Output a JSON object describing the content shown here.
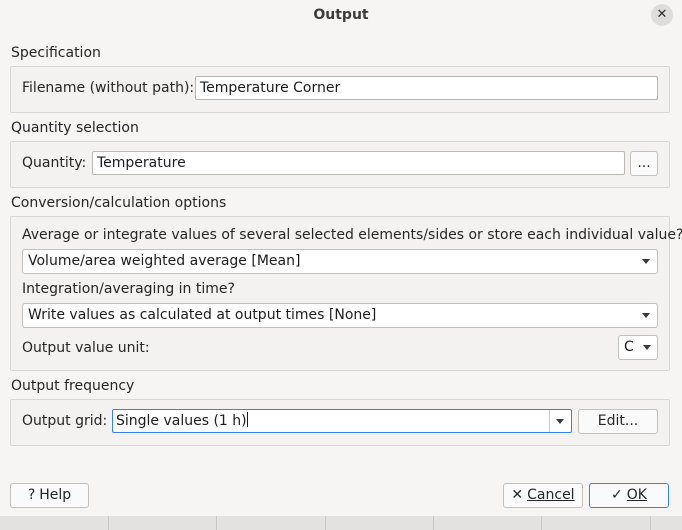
{
  "window": {
    "title": "Output",
    "close_glyph": "✕"
  },
  "specification": {
    "heading": "Specification",
    "filename_label": "Filename (without path):",
    "filename_value": "Temperature Corner"
  },
  "quantity_selection": {
    "heading": "Quantity selection",
    "quantity_label": "Quantity:",
    "quantity_value": "Temperature",
    "browse_label": "..."
  },
  "conversion": {
    "heading": "Conversion/calculation options",
    "average_question": "Average or integrate values of several selected elements/sides or store each individual value?",
    "average_selected": "Volume/area weighted average [Mean]",
    "time_question": "Integration/averaging in time?",
    "time_selected": "Write values as calculated at output times [None]",
    "unit_label": "Output value unit:",
    "unit_selected": "C"
  },
  "output_frequency": {
    "heading": "Output frequency",
    "grid_label": "Output grid:",
    "grid_value": "Single values (1 h)",
    "edit_label": "Edit..."
  },
  "buttons": {
    "help_icon": "?",
    "help_label": "Help",
    "cancel_icon": "✕",
    "cancel_label": "Cancel",
    "ok_icon": "✓",
    "ok_label": "OK"
  },
  "colors": {
    "accent": "#3584e4",
    "dialog_bg": "#f6f5f4",
    "group_border": "#d8d6d3"
  }
}
